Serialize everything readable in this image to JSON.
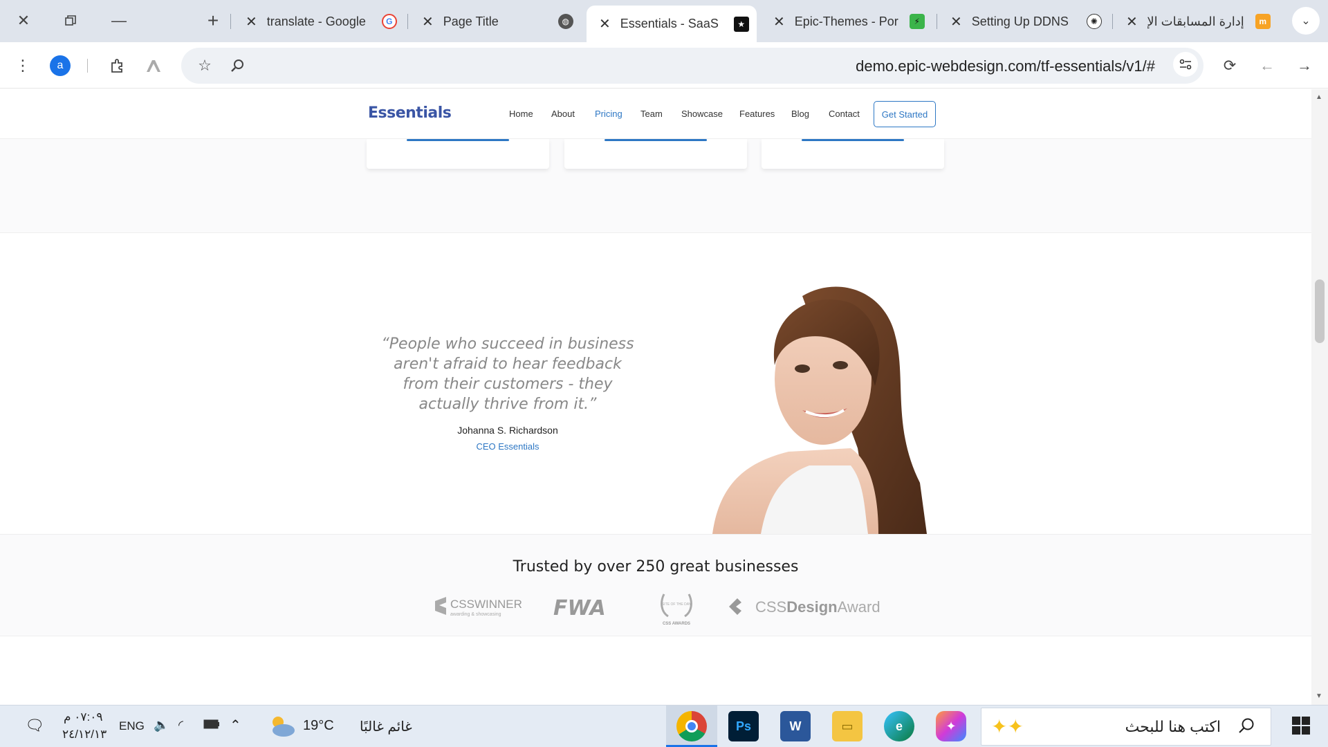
{
  "browser": {
    "tabs": [
      {
        "title": "translate - Google",
        "favicon": "google-icon"
      },
      {
        "title": "Page Title",
        "favicon": "globe-icon"
      },
      {
        "title": "Essentials - SaaS La",
        "favicon": "star-icon",
        "active": true
      },
      {
        "title": "Epic-Themes - Port",
        "favicon": "bolt-icon"
      },
      {
        "title": "Setting Up DDNS",
        "favicon": "openai-icon"
      },
      {
        "title": "إدارة المسابقات الإلك",
        "favicon": "moodle-icon"
      }
    ],
    "profile_initial": "a",
    "url": "demo.epic-webdesign.com/tf-essentials/v1/#"
  },
  "site": {
    "brand": "Essentials",
    "nav": [
      "Home",
      "About",
      "Pricing",
      "Team",
      "Showcase",
      "Features",
      "Blog",
      "Contact"
    ],
    "nav_active": "Pricing",
    "cta": "Get Started",
    "accent": "#2d77c4",
    "testimonial": {
      "quote": "“People who succeed in business aren't afraid to hear feedback from their customers - they actually thrive from it.”",
      "author": "Johanna S. Richardson",
      "role": "CEO Essentials"
    },
    "trusted_title": "Trusted by over 250 great businesses",
    "logos": {
      "csswinner": "CSSWINNER",
      "csswinner_sub": "awarding & showcasing",
      "fwa": "FWA",
      "cssawards_top": "SITE OF THE DAY",
      "cssawards": "CSS AWARDS",
      "cssdesign_a": "CSS",
      "cssdesign_b": "Design",
      "cssdesign_c": "Awards"
    }
  },
  "taskbar": {
    "time": "٠٧:٠٩ م",
    "date": "٢٤/١٢/١٣",
    "language": "ENG",
    "weather_temp": "19°C",
    "weather_text": "غائم غالبًا",
    "search_placeholder": "اكتب هنا للبحث"
  }
}
